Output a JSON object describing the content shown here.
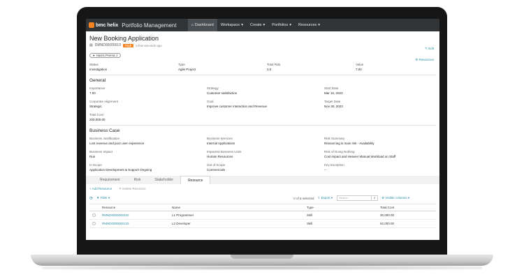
{
  "header": {
    "brand": "bmc helix",
    "app_name": "Portfolio Management",
    "nav": [
      {
        "label": "Dashboard",
        "icon": "home-icon"
      },
      {
        "label": "Workspace"
      },
      {
        "label": "Create"
      },
      {
        "label": "Portfolios"
      },
      {
        "label": "Resources"
      }
    ]
  },
  "record": {
    "title": "New Booking Application",
    "id": "DMND00000019",
    "priority": "High",
    "updated": "a few seconds ago",
    "owner": "Harris Prerna J",
    "edit_label": "Edit",
    "resources_label": "Resources"
  },
  "summary": [
    {
      "label": "Status",
      "value": "Investigation"
    },
    {
      "label": "Type",
      "value": "Agile Project"
    },
    {
      "label": "Total Risk",
      "value": "3.0"
    },
    {
      "label": "Value",
      "value": "7.00"
    }
  ],
  "general": {
    "title": "General",
    "fields": [
      {
        "label": "Importance",
        "value": "7.00"
      },
      {
        "label": "Strategy",
        "value": "Customer satisfaction"
      },
      {
        "label": "Start Date",
        "value": "Mar 15, 2023"
      },
      {
        "label": "Corporate Alignment",
        "value": "Strategic"
      },
      {
        "label": "Goal",
        "value": "Improve customer interaction and Revenue"
      },
      {
        "label": "Target Date",
        "value": "Nov 30, 2023"
      },
      {
        "label": "Total Cost",
        "value": "200,000.00"
      }
    ]
  },
  "business_case": {
    "title": "Business Case",
    "fields": [
      {
        "label": "Business Justification",
        "value": "Lost revenue and poor user experience"
      },
      {
        "label": "Business Services",
        "value": "Internal Applications"
      },
      {
        "label": "Risk Summary",
        "value": "Resourcing is main risk - Availability"
      },
      {
        "label": "Business Impact",
        "value": "Run"
      },
      {
        "label": "Impacted Business Units",
        "value": "Human Resources"
      },
      {
        "label": "Risk of Doing Nothing",
        "value": "Cost impact and Heavier Manual Workload on Staff"
      },
      {
        "label": "In Scope",
        "value": "Application Development & Support Ongoing"
      },
      {
        "label": "Out of Scope",
        "value": "Commercials"
      },
      {
        "label": "Key Exception",
        "value": "--"
      }
    ]
  },
  "tabs": [
    "Requirement",
    "Risk",
    "Stakeholder",
    "Resource"
  ],
  "active_tab": "Resource",
  "resource": {
    "add_label": "Add Resource",
    "delete_label": "Delete Resource",
    "filter_label": "Filter",
    "count_label": "0 of 6 selected",
    "export_label": "Export",
    "search_placeholder": "Search",
    "visible_columns_label": "Visible columns",
    "columns": [
      "Resource",
      "Name",
      "Type",
      "Total Cost"
    ],
    "rows": [
      [
        "RMND0000000132",
        "L1 Programmer",
        "Skill",
        "30,000.00"
      ],
      [
        "RMND0000000133",
        "L2 Developer",
        "Skill",
        "62,000.00"
      ]
    ]
  },
  "colors": {
    "accent": "#2b8fa6",
    "priority": "#f58220",
    "topbar": "#313538"
  }
}
